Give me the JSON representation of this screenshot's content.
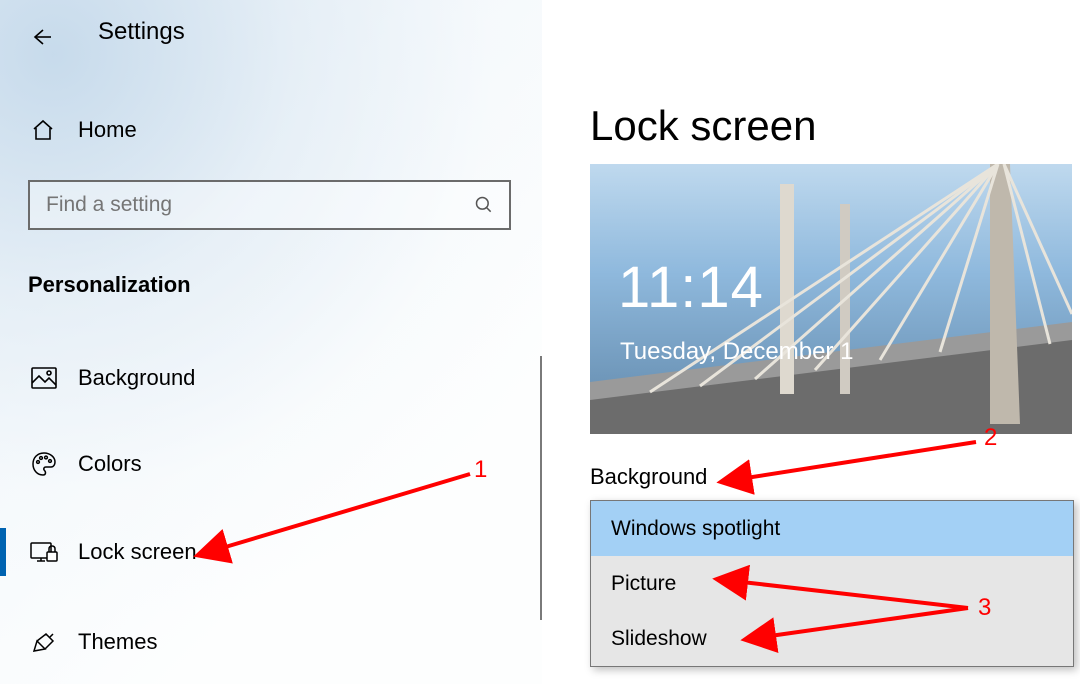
{
  "header": {
    "title": "Settings"
  },
  "sidebar": {
    "home_label": "Home",
    "search_placeholder": "Find a setting",
    "category_header": "Personalization",
    "items": [
      {
        "label": "Background"
      },
      {
        "label": "Colors"
      },
      {
        "label": "Lock screen",
        "selected": true
      },
      {
        "label": "Themes"
      }
    ]
  },
  "main": {
    "page_title": "Lock screen",
    "preview": {
      "time": "11:14",
      "date": "Tuesday, December 1"
    },
    "background_label": "Background",
    "dropdown": {
      "options": [
        {
          "label": "Windows spotlight",
          "selected": true
        },
        {
          "label": "Picture"
        },
        {
          "label": "Slideshow"
        }
      ]
    }
  },
  "annotations": {
    "n1": "1",
    "n2": "2",
    "n3": "3"
  }
}
